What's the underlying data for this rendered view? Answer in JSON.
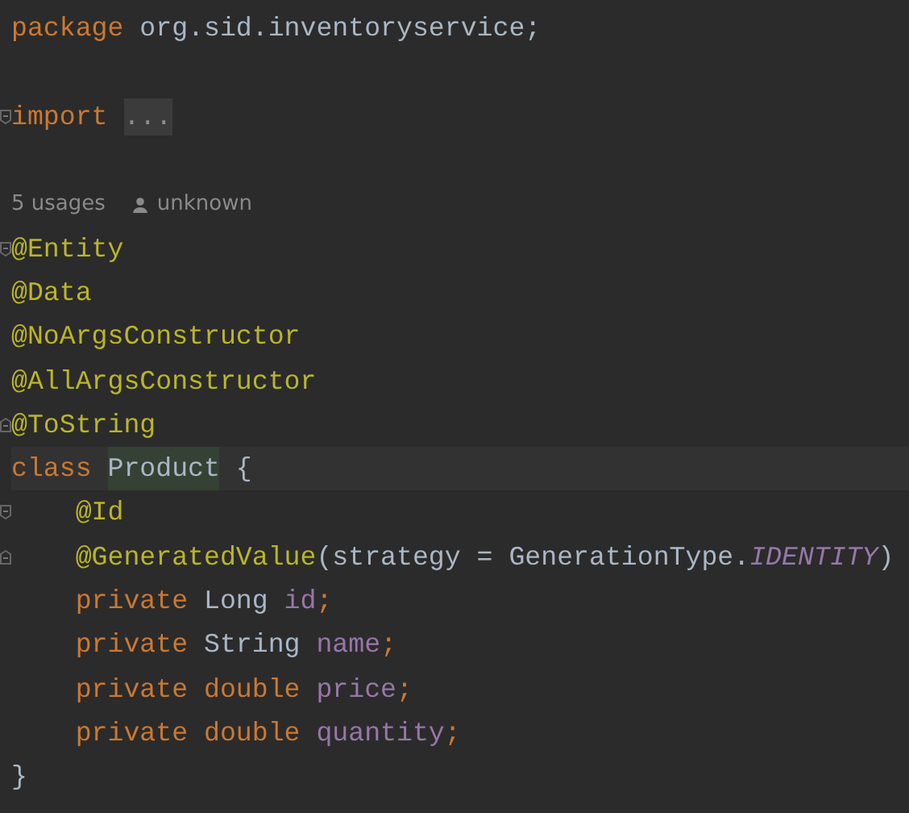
{
  "editor": {
    "lines": [
      {
        "kind": "code",
        "fold_start": false,
        "fold_end": false,
        "tokens": [
          {
            "text": "package ",
            "kind": "keyword"
          },
          {
            "text": "org.sid.inventoryservice;",
            "kind": "plain"
          }
        ]
      },
      {
        "kind": "blank",
        "fold_start": false,
        "fold_end": false
      },
      {
        "kind": "code",
        "fold_start": true,
        "fold_end": false,
        "tokens": [
          {
            "text": "import ",
            "kind": "keyword"
          },
          {
            "text": "...",
            "kind": "folded"
          }
        ]
      },
      {
        "kind": "blank",
        "fold_start": false,
        "fold_end": false
      },
      {
        "kind": "hint",
        "fold_start": false,
        "fold_end": false,
        "usages": "5 usages",
        "author": "unknown"
      },
      {
        "kind": "code",
        "fold_start": true,
        "fold_end": false,
        "tokens": [
          {
            "text": "@Entity",
            "kind": "annotation"
          }
        ]
      },
      {
        "kind": "code",
        "fold_start": false,
        "fold_end": false,
        "tokens": [
          {
            "text": "@Data",
            "kind": "annotation"
          }
        ]
      },
      {
        "kind": "code",
        "fold_start": false,
        "fold_end": false,
        "tokens": [
          {
            "text": "@NoArgsConstructor",
            "kind": "annotation"
          }
        ]
      },
      {
        "kind": "code",
        "fold_start": false,
        "fold_end": false,
        "tokens": [
          {
            "text": "@AllArgsConstructor",
            "kind": "annotation"
          }
        ]
      },
      {
        "kind": "code",
        "fold_start": false,
        "fold_end": true,
        "tokens": [
          {
            "text": "@ToString",
            "kind": "annotation"
          }
        ]
      },
      {
        "kind": "code",
        "fold_start": false,
        "fold_end": false,
        "tokens": [
          {
            "text": "class ",
            "kind": "keyword"
          },
          {
            "text": "Product",
            "kind": "plain",
            "highlighted": true
          },
          {
            "text": " {",
            "kind": "plain"
          }
        ]
      },
      {
        "kind": "code",
        "fold_start": true,
        "fold_end": false,
        "tokens": [
          {
            "text": "    @Id",
            "kind": "annotation"
          }
        ]
      },
      {
        "kind": "code",
        "fold_start": false,
        "fold_end": true,
        "tokens": [
          {
            "text": "    @GeneratedValue",
            "kind": "annotation"
          },
          {
            "text": "(strategy = GenerationType.",
            "kind": "plain"
          },
          {
            "text": "IDENTITY",
            "kind": "constant"
          },
          {
            "text": ")",
            "kind": "plain"
          }
        ]
      },
      {
        "kind": "code",
        "fold_start": false,
        "fold_end": false,
        "tokens": [
          {
            "text": "    private ",
            "kind": "keyword"
          },
          {
            "text": "Long ",
            "kind": "plain"
          },
          {
            "text": "id",
            "kind": "field"
          },
          {
            "text": ";",
            "kind": "keyword"
          }
        ]
      },
      {
        "kind": "code",
        "fold_start": false,
        "fold_end": false,
        "tokens": [
          {
            "text": "    private ",
            "kind": "keyword"
          },
          {
            "text": "String ",
            "kind": "plain"
          },
          {
            "text": "name",
            "kind": "field"
          },
          {
            "text": ";",
            "kind": "keyword"
          }
        ]
      },
      {
        "kind": "code",
        "fold_start": false,
        "fold_end": false,
        "tokens": [
          {
            "text": "    private double ",
            "kind": "keyword"
          },
          {
            "text": "price",
            "kind": "field"
          },
          {
            "text": ";",
            "kind": "keyword"
          }
        ]
      },
      {
        "kind": "code",
        "fold_start": false,
        "fold_end": false,
        "tokens": [
          {
            "text": "    private double ",
            "kind": "keyword"
          },
          {
            "text": "quantity",
            "kind": "field"
          },
          {
            "text": ";",
            "kind": "keyword"
          }
        ]
      },
      {
        "kind": "code",
        "fold_start": false,
        "fold_end": false,
        "tokens": [
          {
            "text": "}",
            "kind": "plain"
          }
        ]
      }
    ]
  }
}
